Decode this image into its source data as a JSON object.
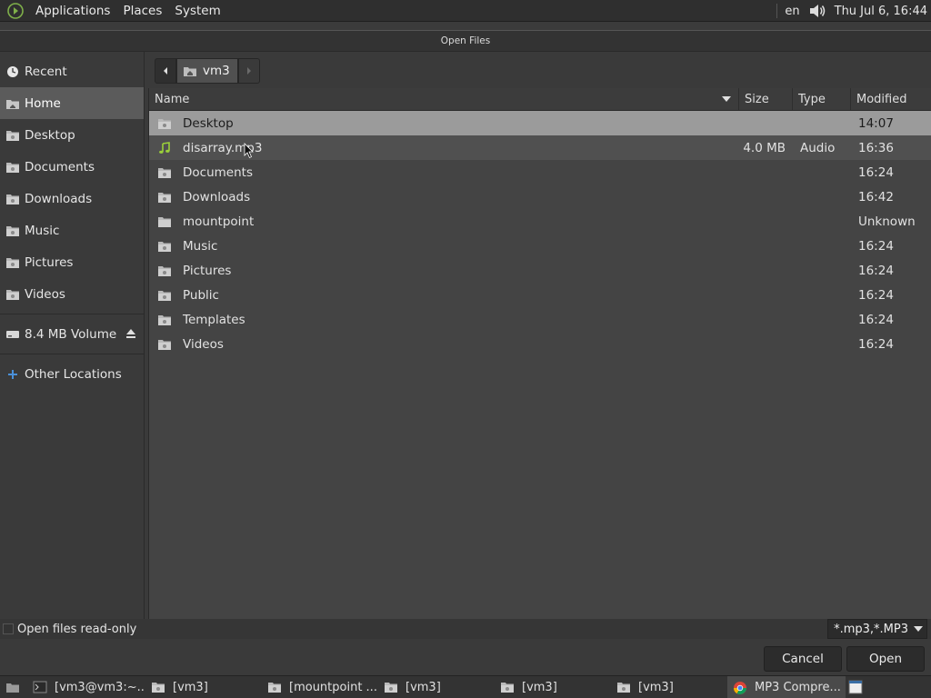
{
  "top_panel": {
    "menus": [
      "Applications",
      "Places",
      "System"
    ],
    "language": "en",
    "clock": "Thu Jul  6, 16:44"
  },
  "dialog": {
    "title": "Open Files",
    "sidebar": {
      "items": [
        {
          "label": "Recent",
          "icon": "recent-icon"
        },
        {
          "label": "Home",
          "icon": "home-folder-icon",
          "active": true
        },
        {
          "label": "Desktop",
          "icon": "folder-icon"
        },
        {
          "label": "Documents",
          "icon": "folder-icon"
        },
        {
          "label": "Downloads",
          "icon": "folder-icon"
        },
        {
          "label": "Music",
          "icon": "folder-icon"
        },
        {
          "label": "Pictures",
          "icon": "folder-icon"
        },
        {
          "label": "Videos",
          "icon": "folder-icon"
        }
      ],
      "volume": {
        "label": "8.4 MB Volume",
        "icon": "drive-icon"
      },
      "other": {
        "label": "Other Locations",
        "icon": "plus-icon"
      }
    },
    "pathbar": {
      "crumb": "vm3"
    },
    "columns": {
      "name": "Name",
      "size": "Size",
      "type": "Type",
      "modified": "Modified"
    },
    "files": [
      {
        "name": "Desktop",
        "size": "",
        "type": "",
        "modified": "14:07",
        "icon": "folder-icon"
      },
      {
        "name": "disarray.mp3",
        "size": "4.0 MB",
        "type": "Audio",
        "modified": "16:36",
        "icon": "audio-file-icon"
      },
      {
        "name": "Documents",
        "size": "",
        "type": "",
        "modified": "16:24",
        "icon": "folder-icon"
      },
      {
        "name": "Downloads",
        "size": "",
        "type": "",
        "modified": "16:42",
        "icon": "folder-icon"
      },
      {
        "name": "mountpoint",
        "size": "",
        "type": "",
        "modified": "Unknown",
        "icon": "plain-folder-icon"
      },
      {
        "name": "Music",
        "size": "",
        "type": "",
        "modified": "16:24",
        "icon": "folder-icon"
      },
      {
        "name": "Pictures",
        "size": "",
        "type": "",
        "modified": "16:24",
        "icon": "folder-icon"
      },
      {
        "name": "Public",
        "size": "",
        "type": "",
        "modified": "16:24",
        "icon": "folder-icon"
      },
      {
        "name": "Templates",
        "size": "",
        "type": "",
        "modified": "16:24",
        "icon": "folder-icon"
      },
      {
        "name": "Videos",
        "size": "",
        "type": "",
        "modified": "16:24",
        "icon": "folder-icon"
      }
    ],
    "readonly_label": "Open files read-only",
    "filter": "*.mp3,*.MP3",
    "cancel_label": "Cancel",
    "open_label": "Open"
  },
  "taskbar": {
    "tasks": [
      {
        "label": "[vm3@vm3:~...",
        "icon": "terminal-icon"
      },
      {
        "label": "[vm3]",
        "icon": "folder-icon"
      },
      {
        "label": "[mountpoint ...",
        "icon": "folder-icon"
      },
      {
        "label": "[vm3]",
        "icon": "folder-icon"
      },
      {
        "label": "[vm3]",
        "icon": "folder-icon"
      },
      {
        "label": "[vm3]",
        "icon": "folder-icon"
      },
      {
        "label": "MP3 Compre...",
        "icon": "chrome-icon",
        "active": true
      }
    ]
  },
  "colors": {
    "selected_row": "#9b9b9b",
    "active_place": "#5b5b5b",
    "accent_blue": "#4a90d9"
  }
}
